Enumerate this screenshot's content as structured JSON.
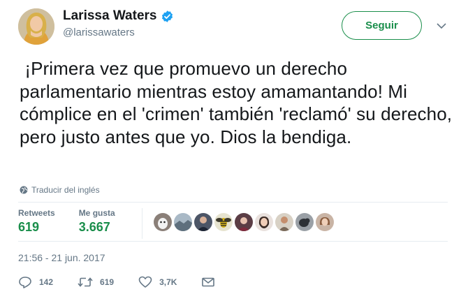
{
  "author": {
    "name": "Larissa Waters",
    "handle": "@larissawaters",
    "verified": true,
    "avatar": "avatar-photo-blonde-woman"
  },
  "follow_button": {
    "label": "Seguir"
  },
  "menu": {
    "icon": "chevron-down-icon"
  },
  "tweet": {
    "text": " ¡Primera vez que promuevo un derecho parlamentario mientras estoy amamantando! Mi cómplice en el 'crimen' también 'reclamó' su derecho, pero justo antes que yo. Dios la bendiga.",
    "translate_label": "Traducir del inglés",
    "timestamp": "21:56 - 21 jun. 2017"
  },
  "stats": {
    "retweets_label": "Retweets",
    "retweets_value": "619",
    "likes_label": "Me gusta",
    "likes_value": "3.667"
  },
  "likers": [
    "liker-avatar-1",
    "liker-avatar-2",
    "liker-avatar-3",
    "liker-avatar-4",
    "liker-avatar-5",
    "liker-avatar-6",
    "liker-avatar-7",
    "liker-avatar-8",
    "liker-avatar-9"
  ],
  "actions": {
    "reply_count": "142",
    "retweet_count": "619",
    "like_count": "3,7K"
  },
  "colors": {
    "accent": "#1a8e4b",
    "verified": "#1da1f2",
    "muted": "#657786"
  }
}
